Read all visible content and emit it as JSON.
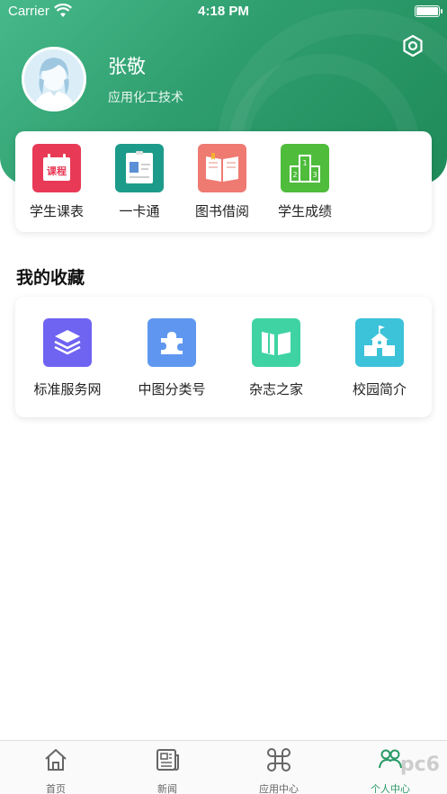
{
  "status_bar": {
    "carrier": "Carrier",
    "time": "4:18 PM"
  },
  "profile": {
    "name": "张敬",
    "major": "应用化工技术"
  },
  "quick_actions": [
    {
      "label": "学生课表",
      "icon_text": "课程",
      "icon": "calendar-icon",
      "color": "#e83a56"
    },
    {
      "label": "一卡通",
      "icon": "id-card-icon",
      "color": "#1c9b8a"
    },
    {
      "label": "图书借阅",
      "icon": "book-icon",
      "color": "#ef7a72"
    },
    {
      "label": "学生成绩",
      "icon": "podium-icon",
      "icon_digits": [
        "1",
        "2",
        "3"
      ],
      "color": "#4fbc3c"
    }
  ],
  "favorites": {
    "title": "我的收藏",
    "items": [
      {
        "label": "标准服务网",
        "icon": "layers-icon",
        "color": "#6f63f2"
      },
      {
        "label": "中图分类号",
        "icon": "puzzle-icon",
        "color": "#5f97f0"
      },
      {
        "label": "杂志之家",
        "icon": "open-book-icon",
        "color": "#3fd3a3"
      },
      {
        "label": "校园简介",
        "icon": "school-icon",
        "color": "#3cc2d9"
      }
    ]
  },
  "tabbar": {
    "tabs": [
      {
        "label": "首页",
        "icon": "home-icon"
      },
      {
        "label": "新闻",
        "icon": "news-icon"
      },
      {
        "label": "应用中心",
        "icon": "command-icon"
      },
      {
        "label": "个人中心",
        "icon": "people-icon",
        "active": true
      }
    ]
  },
  "watermark": "pc6"
}
